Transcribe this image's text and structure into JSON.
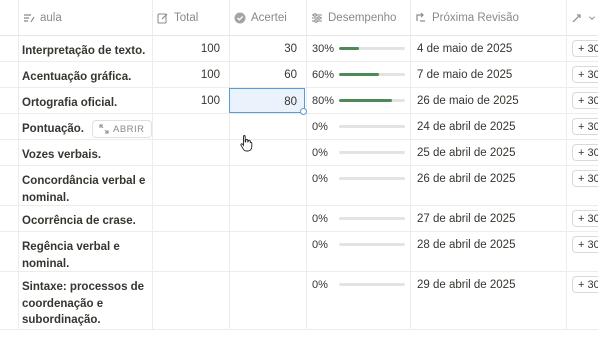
{
  "columns": {
    "aula": "aula",
    "total": "Total",
    "acertei": "Acertei",
    "desempenho": "Desempenho",
    "proxima_revisao": "Próxima Revisão"
  },
  "open_button_label": "ABRIR",
  "add_label": "+ 30",
  "rows": [
    {
      "aula": "Interpretação de texto.",
      "total": "100",
      "acertei": "30",
      "desempenho": "30%",
      "progress": 0.3,
      "proxima": "4 de maio de 2025"
    },
    {
      "aula": "Acentuação gráfica.",
      "total": "100",
      "acertei": "60",
      "desempenho": "60%",
      "progress": 0.6,
      "proxima": "7 de maio de 2025"
    },
    {
      "aula": "Ortografia oficial.",
      "total": "100",
      "acertei": "80",
      "desempenho": "80%",
      "progress": 0.8,
      "proxima": "26 de maio de 2025"
    },
    {
      "aula": "Pontuação.",
      "total": "",
      "acertei": "",
      "desempenho": "0%",
      "progress": 0,
      "proxima": "24 de abril de 2025"
    },
    {
      "aula": "Vozes verbais.",
      "total": "",
      "acertei": "",
      "desempenho": "0%",
      "progress": 0,
      "proxima": "25 de abril de 2025"
    },
    {
      "aula": "Concordância verbal e nominal.",
      "total": "",
      "acertei": "",
      "desempenho": "0%",
      "progress": 0,
      "proxima": "26 de abril de 2025"
    },
    {
      "aula": "Ocorrência de crase.",
      "total": "",
      "acertei": "",
      "desempenho": "0%",
      "progress": 0,
      "proxima": "27 de abril de 2025"
    },
    {
      "aula": "Regência verbal e nominal.",
      "total": "",
      "acertei": "",
      "desempenho": "0%",
      "progress": 0,
      "proxima": "28 de abril de 2025"
    },
    {
      "aula": "Sintaxe: processos de coordenação e subordinação.",
      "total": "",
      "acertei": "",
      "desempenho": "0%",
      "progress": 0,
      "proxima": "29 de abril de 2025"
    }
  ],
  "colors": {
    "progress_fill": "#4e8a57",
    "selection": "#5a9bd5"
  }
}
